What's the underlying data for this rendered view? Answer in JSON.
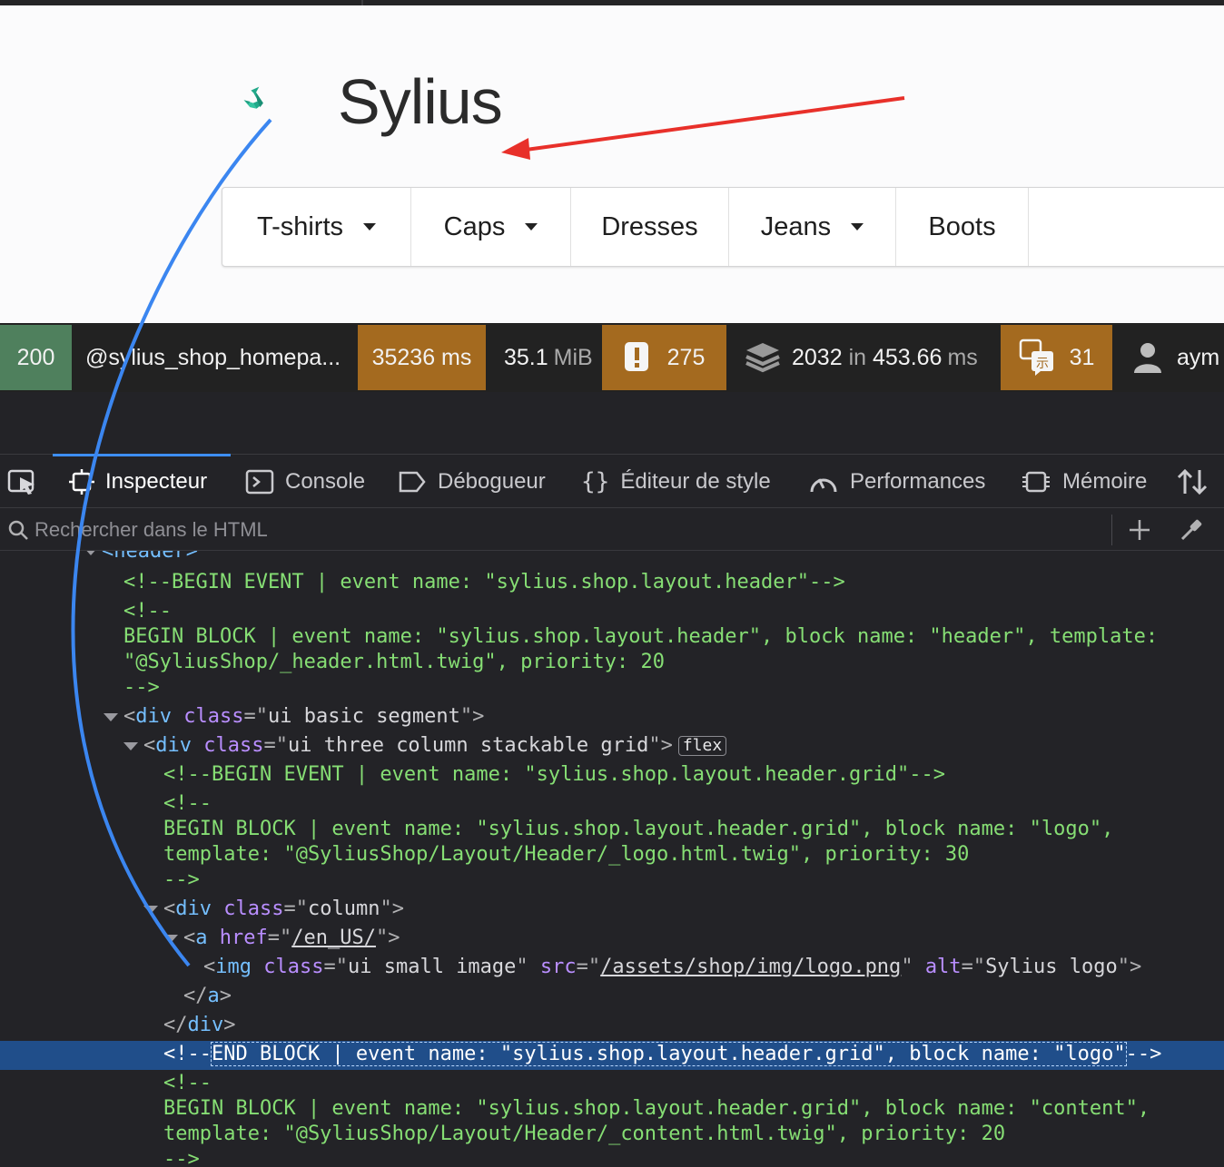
{
  "shop": {
    "logo_text": "Sylius",
    "menu": [
      {
        "label": "T-shirts",
        "dropdown": true
      },
      {
        "label": "Caps",
        "dropdown": true
      },
      {
        "label": "Dresses",
        "dropdown": false
      },
      {
        "label": "Jeans",
        "dropdown": true
      },
      {
        "label": "Boots",
        "dropdown": false
      }
    ]
  },
  "toolbar": {
    "status": "200",
    "route": "@sylius_shop_homepa...",
    "time": "35236 ms",
    "memory_value": "35.1",
    "memory_unit": "MiB",
    "warnings": "275",
    "db_queries": "2032",
    "db_in": "in",
    "db_time": "453.66",
    "db_unit": "ms",
    "translations": "31",
    "user": "aym",
    "colors": {
      "success": "#4f805d",
      "warning": "#a46a1f"
    }
  },
  "devtools": {
    "tabs": {
      "inspector": "Inspecteur",
      "console": "Console",
      "debugger": "Débogueur",
      "style_editor": "Éditeur de style",
      "performance": "Performances",
      "memory": "Mémoire"
    },
    "search_placeholder": "Rechercher dans le HTML",
    "lines": {
      "l0": "header>",
      "l1": "<!--BEGIN EVENT | event name: \"sylius.shop.layout.header\"-->",
      "l2": "<!--",
      "l3": "BEGIN BLOCK | event name: \"sylius.shop.layout.header\", block name: \"header\", template:",
      "l4": "\"@SyliusShop/_header.html.twig\", priority: 20",
      "l5": "-->",
      "l6_tag": "div",
      "l6_attr": "class",
      "l6_val": "ui basic segment",
      "l7_tag": "div",
      "l7_attr": "class",
      "l7_val": "ui three column stackable grid",
      "l7_badge": "flex",
      "l8": "<!--BEGIN EVENT | event name: \"sylius.shop.layout.header.grid\"-->",
      "l9": "<!--",
      "l10": "BEGIN BLOCK | event name: \"sylius.shop.layout.header.grid\", block name: \"logo\",",
      "l11": "template: \"@SyliusShop/Layout/Header/_logo.html.twig\", priority: 30",
      "l12": "-->",
      "l13_tag": "div",
      "l13_attr": "class",
      "l13_val": "column",
      "l14_tag": "a",
      "l14_attr": "href",
      "l14_val": "/en_US/",
      "l15_tag": "img",
      "l15_a1": "class",
      "l15_v1": "ui small image",
      "l15_a2": "src",
      "l15_v2": "/assets/shop/img/logo.png",
      "l15_a3": "alt",
      "l15_v3": "Sylius logo",
      "l16_tag": "a",
      "l17_tag": "div",
      "l18_start": "<!--",
      "l18_mid": "END BLOCK | event name: \"sylius.shop.layout.header.grid\", block name: \"logo\"",
      "l18_end": "-->",
      "l19": "<!--",
      "l20": "BEGIN BLOCK | event name: \"sylius.shop.layout.header.grid\", block name: \"content\",",
      "l21": "template: \"@SyliusShop/Layout/Header/_content.html.twig\", priority: 20",
      "l22": "-->"
    }
  },
  "annotation_colors": {
    "arrow_red": "#e8302a",
    "arrow_blue": "#3b86f0"
  }
}
